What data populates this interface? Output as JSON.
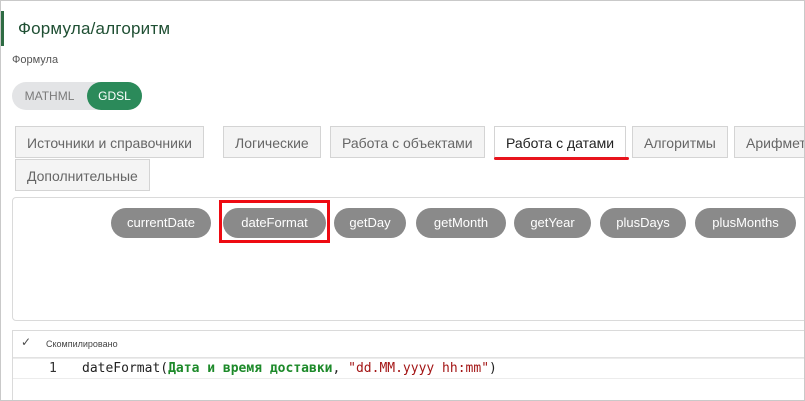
{
  "header": {
    "title": "Формула/алгоритм"
  },
  "formula": {
    "label": "Формула"
  },
  "mode_toggle": {
    "options": [
      "MATHML",
      "GDSL"
    ],
    "selected": "GDSL"
  },
  "tabs": [
    {
      "label": "Источники и справочники",
      "active": false
    },
    {
      "label": "Логические",
      "active": false
    },
    {
      "label": "Работа с объектами",
      "active": false
    },
    {
      "label": "Работа с датами",
      "active": true
    },
    {
      "label": "Алгоритмы",
      "active": false
    },
    {
      "label": "Арифметические",
      "active": false
    },
    {
      "label": "Дополнительные",
      "active": false
    }
  ],
  "functions": [
    "currentDate",
    "dateFormat",
    "getDay",
    "getMonth",
    "getYear",
    "plusDays",
    "plusMonths"
  ],
  "highlighted_function": "dateFormat",
  "editor": {
    "status": "Скомпилировано",
    "status_icon": "check-icon",
    "lines": [
      {
        "number": "1",
        "fn": "dateFormat",
        "open": "(",
        "param": "Дата и время доставки",
        "sep": ", ",
        "string": "\"dd.MM.yyyy hh:mm\"",
        "close": ")"
      }
    ]
  },
  "colors": {
    "accent": "#2b8a5a",
    "title": "#1f4f33",
    "highlight": "#ee0a12",
    "chip": "#8a8a8a"
  }
}
